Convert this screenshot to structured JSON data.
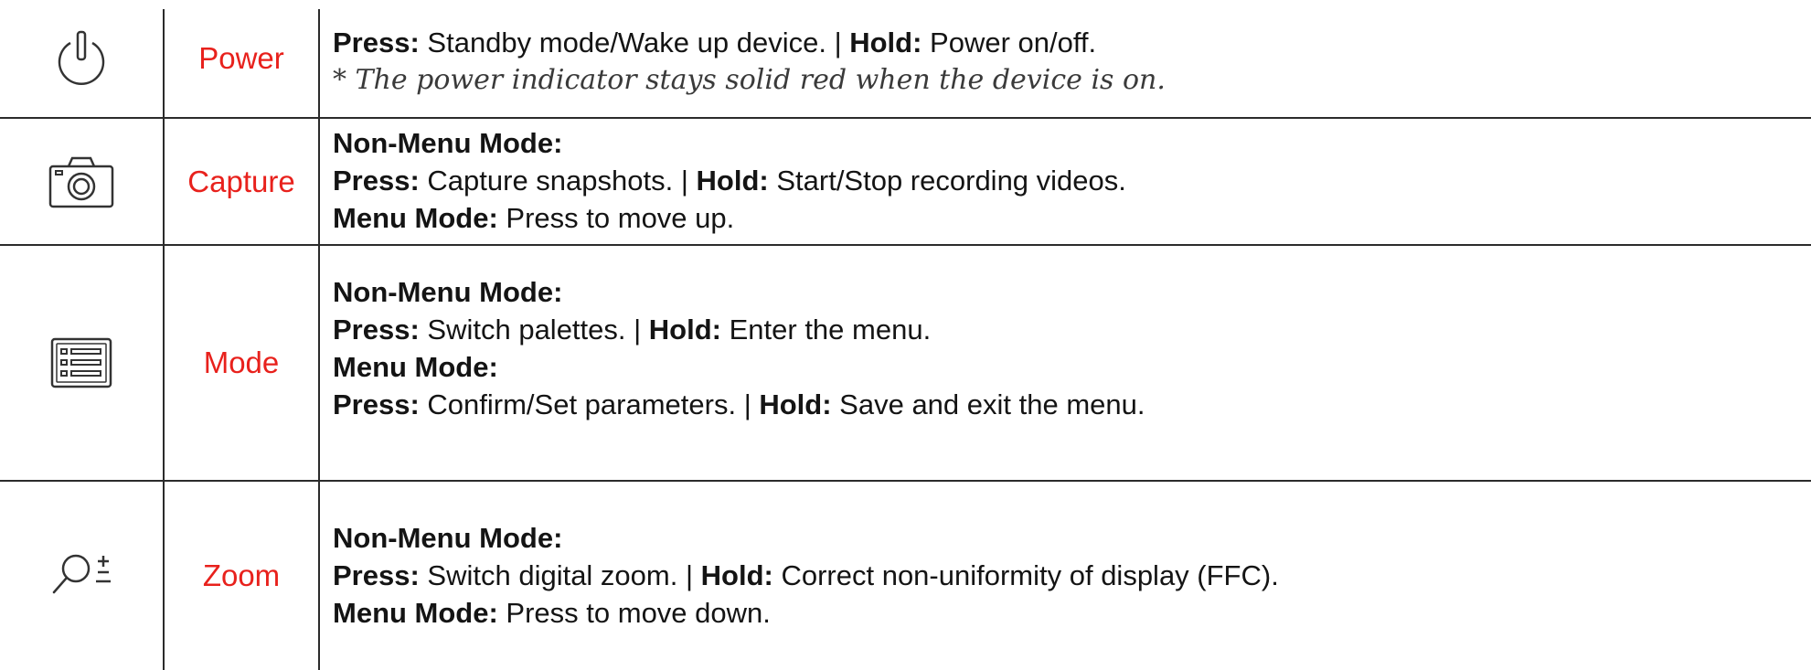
{
  "rows": [
    {
      "icon": "power-icon",
      "name": "Power",
      "lines": [
        {
          "k1": "Press:",
          "t1": " Standby mode/Wake up device. | ",
          "k2": "Hold:",
          "t2": " Power on/off."
        }
      ],
      "note": "* The power indicator stays solid red when the device is on."
    },
    {
      "icon": "camera-icon",
      "name": "Capture",
      "lines": [
        {
          "k1": "Non-Menu Mode:"
        },
        {
          "k1": "Press:",
          "t1": " Capture snapshots. | ",
          "k2": "Hold:",
          "t2": " Start/Stop recording videos."
        },
        {
          "k1": "Menu Mode:",
          "t1": " Press to move up."
        }
      ]
    },
    {
      "icon": "menu-list-icon",
      "name": "Mode",
      "lines": [
        {
          "k1": "Non-Menu Mode:"
        },
        {
          "k1": "Press:",
          "t1": " Switch palettes. | ",
          "k2": "Hold:",
          "t2": " Enter the menu."
        },
        {
          "k1": "Menu Mode:"
        },
        {
          "k1": "Press:",
          "t1": " Confirm/Set parameters. | ",
          "k2": "Hold:",
          "t2": " Save and exit the menu."
        }
      ]
    },
    {
      "icon": "zoom-icon",
      "name": "Zoom",
      "lines": [
        {
          "k1": "Non-Menu Mode:"
        },
        {
          "k1": "Press:",
          "t1": " Switch digital zoom. | ",
          "k2": "Hold:",
          "t2": " Correct non-uniformity of display (FFC)."
        },
        {
          "k1": "Menu Mode:",
          "t1": " Press to move down."
        }
      ]
    }
  ]
}
